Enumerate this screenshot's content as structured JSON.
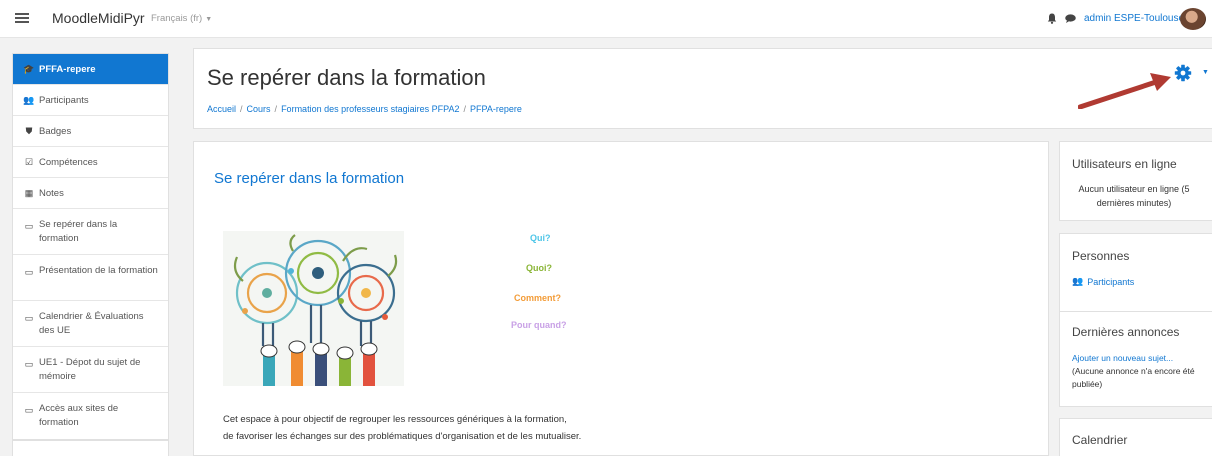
{
  "navbar": {
    "brand": "MoodleMidiPyr",
    "language": "Français (fr)",
    "user_name": "admin ESPE-Toulouse"
  },
  "drawer": {
    "items": [
      {
        "label": "PFFA-repere",
        "icon": "graduation-cap-icon"
      },
      {
        "label": "Participants",
        "icon": "users-icon"
      },
      {
        "label": "Badges",
        "icon": "shield-icon"
      },
      {
        "label": "Compétences",
        "icon": "check-square-icon"
      },
      {
        "label": "Notes",
        "icon": "table-icon"
      },
      {
        "label": "Se repérer dans la formation",
        "icon": "folder-icon"
      },
      {
        "label": "Présentation de la formation",
        "icon": "folder-icon"
      },
      {
        "label": "Calendrier & Évaluations des UE",
        "icon": "folder-icon"
      },
      {
        "label": "UE1 - Dépot du sujet de mémoire",
        "icon": "folder-icon"
      },
      {
        "label": "Accès aux sites de formation",
        "icon": "folder-icon"
      }
    ]
  },
  "header": {
    "title": "Se repérer dans la formation",
    "breadcrumb": [
      "Accueil",
      "Cours",
      "Formation des professeurs stagiaires PFPA2",
      "PFPA-repere"
    ],
    "breadcrumb_sep": "/"
  },
  "main": {
    "section_title": "Se repérer dans la formation",
    "questions": [
      "Qui?",
      "Quoi?",
      "Comment?",
      "Pour quand?"
    ],
    "description_line1": "Cet espace à pour objectif de regrouper les ressources génériques à la formation,",
    "description_line2": "de favoriser les échanges sur des problématiques d'organisation et de les mutualiser."
  },
  "blocks": {
    "online_users": {
      "title": "Utilisateurs en ligne",
      "text": "Aucun utilisateur en ligne (5 dernières minutes)"
    },
    "people": {
      "title": "Personnes",
      "link": "Participants"
    },
    "news": {
      "title": "Dernières annonces",
      "link": "Ajouter un nouveau sujet...",
      "text": "(Aucune annonce n'a encore été publiée)"
    },
    "calendar": {
      "title": "Calendrier"
    }
  },
  "colors": {
    "accent": "#1177d1",
    "arrow": "#b03a32"
  }
}
